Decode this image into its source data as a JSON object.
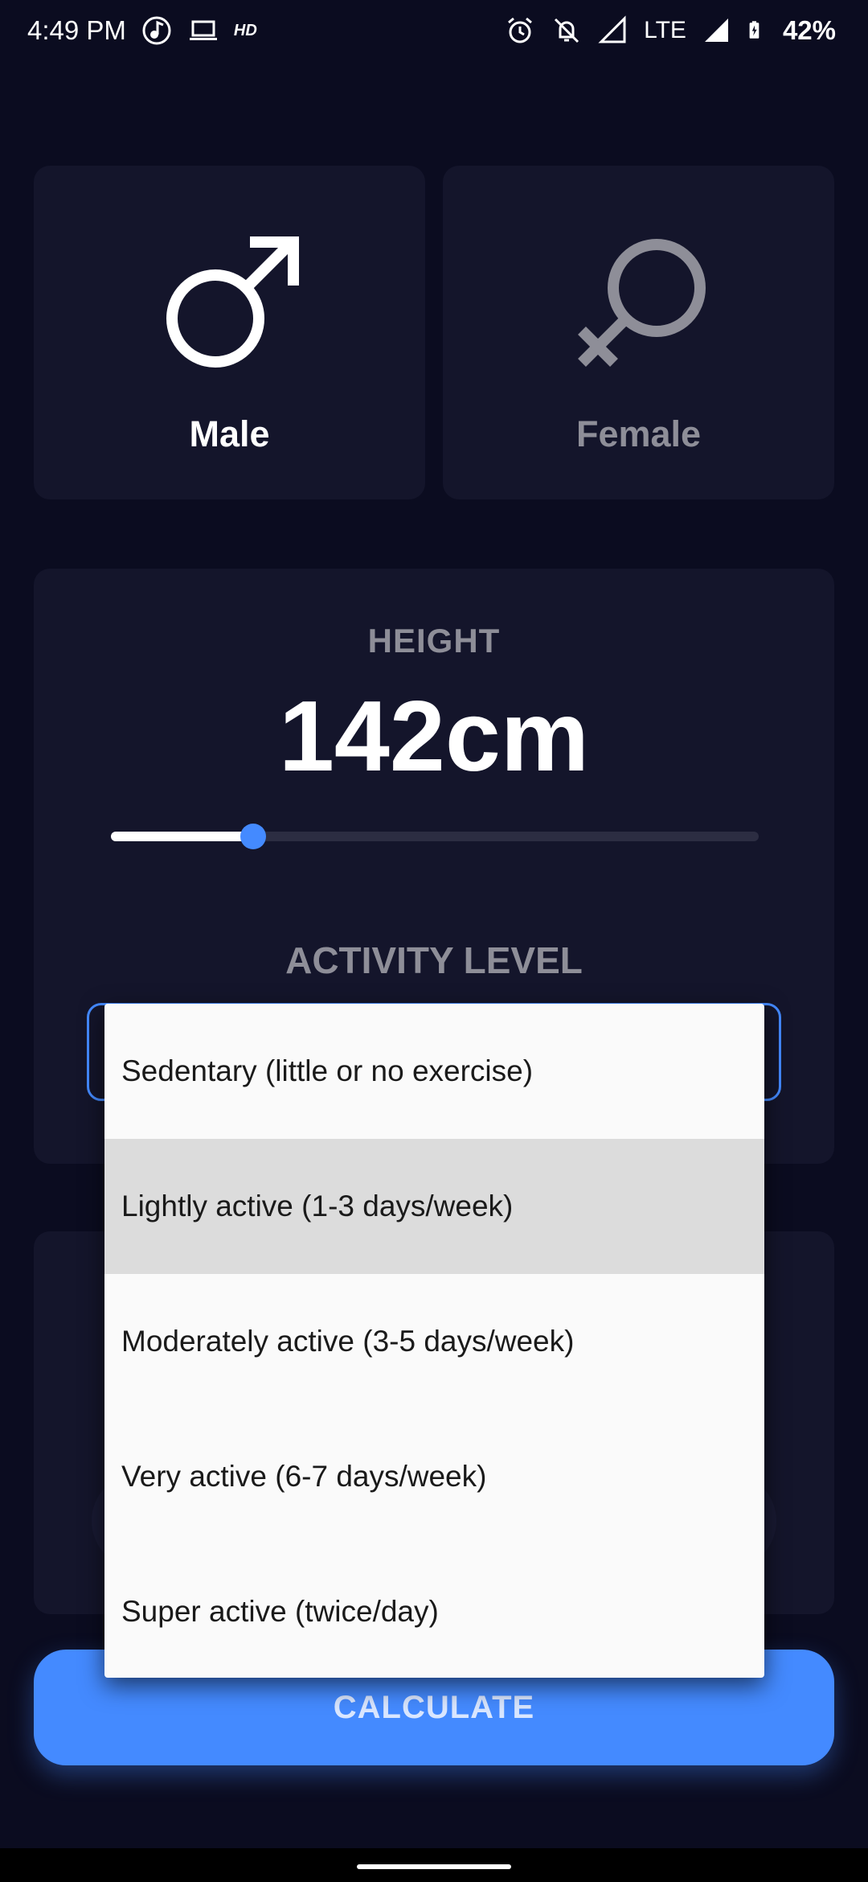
{
  "status_bar": {
    "time": "4:49 PM",
    "hd_label": "HD",
    "network": "LTE",
    "battery": "42%",
    "icons": [
      "music-note-icon",
      "laptop-icon",
      "alarm-icon",
      "bell-off-icon",
      "signal-icon",
      "battery-charging-icon"
    ]
  },
  "gender": {
    "male_label": "Male",
    "female_label": "Female",
    "selected": "Male"
  },
  "height": {
    "title": "HEIGHT",
    "value": "142cm",
    "slider_fraction": 0.22
  },
  "activity": {
    "title": "ACTIVITY LEVEL",
    "options": [
      "Sedentary (little or no exercise)",
      "Lightly active (1-3 days/week)",
      "Moderately active (3-5 days/week)",
      "Very active (6-7 days/week)",
      "Super active (twice/day)"
    ],
    "highlighted_option": "Lightly active (1-3 days/week)"
  },
  "calculate_label": "CALCULATE",
  "colors": {
    "background": "#0b0c20",
    "card": "#14152b",
    "accent": "#448aff",
    "muted_text": "#8e8e98"
  }
}
